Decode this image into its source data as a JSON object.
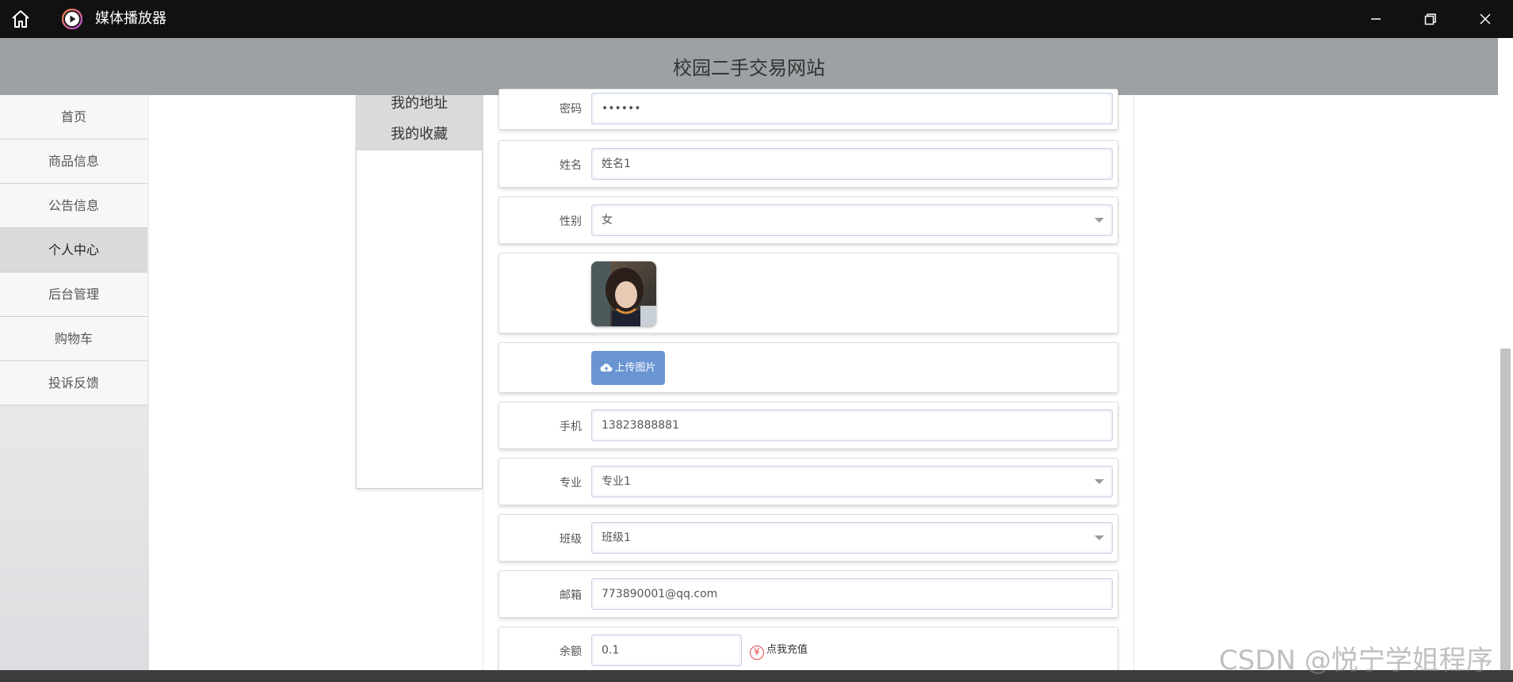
{
  "window": {
    "title": "媒体播放器"
  },
  "site": {
    "title": "校园二手交易网站"
  },
  "left_nav": {
    "items": [
      {
        "label": "首页"
      },
      {
        "label": "商品信息"
      },
      {
        "label": "公告信息"
      },
      {
        "label": "个人中心",
        "active": true
      },
      {
        "label": "后台管理"
      },
      {
        "label": "购物车"
      },
      {
        "label": "投诉反馈"
      }
    ]
  },
  "sub_menu": {
    "items": [
      {
        "label": "我的地址"
      },
      {
        "label": "我的收藏"
      }
    ]
  },
  "form": {
    "password": {
      "label": "密码",
      "value": "••••••"
    },
    "name": {
      "label": "姓名",
      "value": "姓名1"
    },
    "gender": {
      "label": "性别",
      "value": "女"
    },
    "upload_label": "上传图片",
    "phone": {
      "label": "手机",
      "value": "13823888881"
    },
    "major": {
      "label": "专业",
      "value": "专业1"
    },
    "class": {
      "label": "班级",
      "value": "班级1"
    },
    "email": {
      "label": "邮箱",
      "value": "773890001@qq.com"
    },
    "balance": {
      "label": "余额",
      "value": "0.1",
      "recharge_label": "点我充值",
      "recharge_icon": "¥"
    }
  },
  "watermark": "CSDN @悦宁学姐程序",
  "colors": {
    "titlebar": "#111111",
    "header": "#9da1a4",
    "upload_button": "#6a95d3",
    "recharge_icon": "#e14a4a"
  }
}
